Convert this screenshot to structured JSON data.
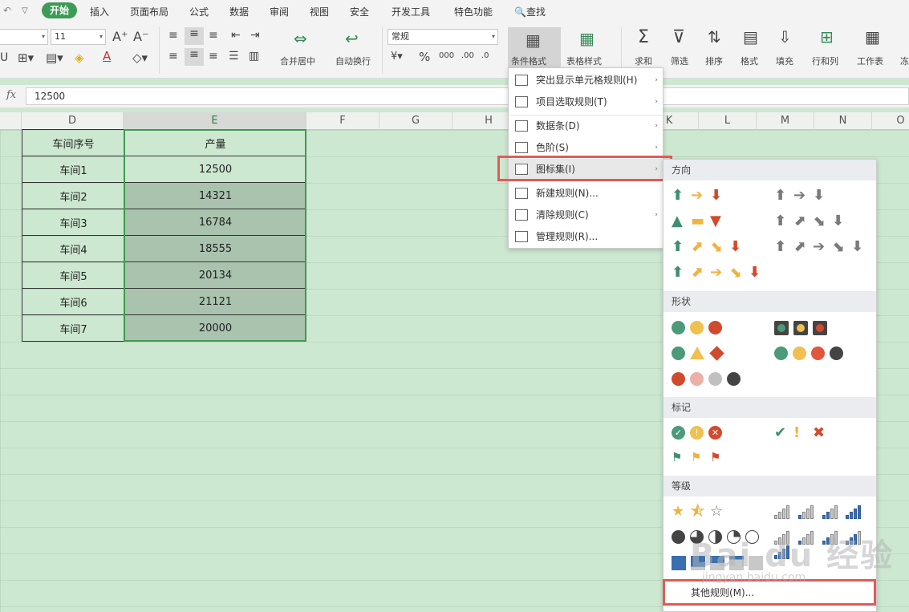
{
  "menubar": {
    "tabs": [
      "开始",
      "插入",
      "页面布局",
      "公式",
      "数据",
      "审阅",
      "视图",
      "安全",
      "开发工具",
      "特色功能"
    ],
    "search": "查找"
  },
  "ribbon": {
    "font_size": "11",
    "number_format": "常规",
    "merge_label": "合并居中",
    "wrap_label": "自动换行",
    "cond_format_label": "条件格式",
    "table_style_label": "表格样式",
    "sum_label": "求和",
    "filter_label": "筛选",
    "sort_label": "排序",
    "format_label": "格式",
    "fill_label": "填充",
    "rowcol_label": "行和列",
    "sheet_label": "工作表",
    "more_label": "冻"
  },
  "formula": {
    "fx": "fx",
    "value": "12500"
  },
  "columns": [
    "D",
    "E",
    "F",
    "G",
    "H",
    "",
    "K",
    "L",
    "M",
    "N",
    "O"
  ],
  "table": {
    "headers": [
      "车间序号",
      "产量"
    ],
    "rows": [
      [
        "车间1",
        "12500"
      ],
      [
        "车间2",
        "14321"
      ],
      [
        "车间3",
        "16784"
      ],
      [
        "车间4",
        "18555"
      ],
      [
        "车间5",
        "20134"
      ],
      [
        "车间6",
        "21121"
      ],
      [
        "车间7",
        "20000"
      ]
    ]
  },
  "cond_menu": {
    "items": [
      {
        "label": "突出显示单元格规则(H)",
        "arrow": "›"
      },
      {
        "label": "项目选取规则(T)",
        "arrow": "›"
      },
      {
        "label": "数据条(D)",
        "arrow": "›"
      },
      {
        "label": "色阶(S)",
        "arrow": "›"
      },
      {
        "label": "图标集(I)",
        "arrow": "›"
      },
      {
        "label": "新建规则(N)...",
        "arrow": ""
      },
      {
        "label": "清除规则(C)",
        "arrow": "›"
      },
      {
        "label": "管理规则(R)...",
        "arrow": ""
      }
    ]
  },
  "iconset_menu": {
    "sections": [
      "方向",
      "形状",
      "标记",
      "等级"
    ],
    "other": "其他规则(M)..."
  },
  "watermark": {
    "main": "Bai du 经验",
    "sub": "jingyan.baidu.com"
  }
}
